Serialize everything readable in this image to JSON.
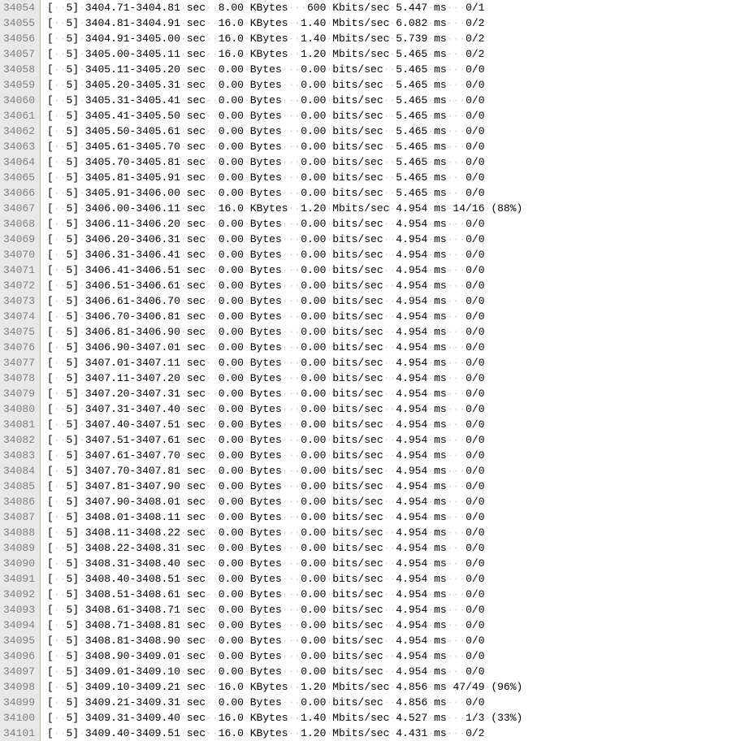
{
  "ws_dot": "·",
  "lines": [
    {
      "ln": "34054",
      "id": "5",
      "interval": "3404.71-3404.81",
      "unit_t": "sec",
      "amt": "8.00",
      "amt_u": "KBytes",
      "rate": "600",
      "rate_u": "Kbits/sec",
      "jit": "5.447",
      "jit_u": "ms",
      "loss": "0/1",
      "pct": ""
    },
    {
      "ln": "34055",
      "id": "5",
      "interval": "3404.81-3404.91",
      "unit_t": "sec",
      "amt": "16.0",
      "amt_u": "KBytes",
      "rate": "1.40",
      "rate_u": "Mbits/sec",
      "jit": "6.082",
      "jit_u": "ms",
      "loss": "0/2",
      "pct": ""
    },
    {
      "ln": "34056",
      "id": "5",
      "interval": "3404.91-3405.00",
      "unit_t": "sec",
      "amt": "16.0",
      "amt_u": "KBytes",
      "rate": "1.40",
      "rate_u": "Mbits/sec",
      "jit": "5.739",
      "jit_u": "ms",
      "loss": "0/2",
      "pct": ""
    },
    {
      "ln": "34057",
      "id": "5",
      "interval": "3405.00-3405.11",
      "unit_t": "sec",
      "amt": "16.0",
      "amt_u": "KBytes",
      "rate": "1.20",
      "rate_u": "Mbits/sec",
      "jit": "5.465",
      "jit_u": "ms",
      "loss": "0/2",
      "pct": ""
    },
    {
      "ln": "34058",
      "id": "5",
      "interval": "3405.11-3405.20",
      "unit_t": "sec",
      "amt": "0.00",
      "amt_u": "Bytes",
      "rate": "0.00",
      "rate_u": "bits/sec",
      "jit": "5.465",
      "jit_u": "ms",
      "loss": "0/0",
      "pct": ""
    },
    {
      "ln": "34059",
      "id": "5",
      "interval": "3405.20-3405.31",
      "unit_t": "sec",
      "amt": "0.00",
      "amt_u": "Bytes",
      "rate": "0.00",
      "rate_u": "bits/sec",
      "jit": "5.465",
      "jit_u": "ms",
      "loss": "0/0",
      "pct": ""
    },
    {
      "ln": "34060",
      "id": "5",
      "interval": "3405.31-3405.41",
      "unit_t": "sec",
      "amt": "0.00",
      "amt_u": "Bytes",
      "rate": "0.00",
      "rate_u": "bits/sec",
      "jit": "5.465",
      "jit_u": "ms",
      "loss": "0/0",
      "pct": ""
    },
    {
      "ln": "34061",
      "id": "5",
      "interval": "3405.41-3405.50",
      "unit_t": "sec",
      "amt": "0.00",
      "amt_u": "Bytes",
      "rate": "0.00",
      "rate_u": "bits/sec",
      "jit": "5.465",
      "jit_u": "ms",
      "loss": "0/0",
      "pct": ""
    },
    {
      "ln": "34062",
      "id": "5",
      "interval": "3405.50-3405.61",
      "unit_t": "sec",
      "amt": "0.00",
      "amt_u": "Bytes",
      "rate": "0.00",
      "rate_u": "bits/sec",
      "jit": "5.465",
      "jit_u": "ms",
      "loss": "0/0",
      "pct": ""
    },
    {
      "ln": "34063",
      "id": "5",
      "interval": "3405.61-3405.70",
      "unit_t": "sec",
      "amt": "0.00",
      "amt_u": "Bytes",
      "rate": "0.00",
      "rate_u": "bits/sec",
      "jit": "5.465",
      "jit_u": "ms",
      "loss": "0/0",
      "pct": ""
    },
    {
      "ln": "34064",
      "id": "5",
      "interval": "3405.70-3405.81",
      "unit_t": "sec",
      "amt": "0.00",
      "amt_u": "Bytes",
      "rate": "0.00",
      "rate_u": "bits/sec",
      "jit": "5.465",
      "jit_u": "ms",
      "loss": "0/0",
      "pct": ""
    },
    {
      "ln": "34065",
      "id": "5",
      "interval": "3405.81-3405.91",
      "unit_t": "sec",
      "amt": "0.00",
      "amt_u": "Bytes",
      "rate": "0.00",
      "rate_u": "bits/sec",
      "jit": "5.465",
      "jit_u": "ms",
      "loss": "0/0",
      "pct": ""
    },
    {
      "ln": "34066",
      "id": "5",
      "interval": "3405.91-3406.00",
      "unit_t": "sec",
      "amt": "0.00",
      "amt_u": "Bytes",
      "rate": "0.00",
      "rate_u": "bits/sec",
      "jit": "5.465",
      "jit_u": "ms",
      "loss": "0/0",
      "pct": ""
    },
    {
      "ln": "34067",
      "id": "5",
      "interval": "3406.00-3406.11",
      "unit_t": "sec",
      "amt": "16.0",
      "amt_u": "KBytes",
      "rate": "1.20",
      "rate_u": "Mbits/sec",
      "jit": "4.954",
      "jit_u": "ms",
      "loss": "14/16",
      "pct": "(88%)"
    },
    {
      "ln": "34068",
      "id": "5",
      "interval": "3406.11-3406.20",
      "unit_t": "sec",
      "amt": "0.00",
      "amt_u": "Bytes",
      "rate": "0.00",
      "rate_u": "bits/sec",
      "jit": "4.954",
      "jit_u": "ms",
      "loss": "0/0",
      "pct": ""
    },
    {
      "ln": "34069",
      "id": "5",
      "interval": "3406.20-3406.31",
      "unit_t": "sec",
      "amt": "0.00",
      "amt_u": "Bytes",
      "rate": "0.00",
      "rate_u": "bits/sec",
      "jit": "4.954",
      "jit_u": "ms",
      "loss": "0/0",
      "pct": ""
    },
    {
      "ln": "34070",
      "id": "5",
      "interval": "3406.31-3406.41",
      "unit_t": "sec",
      "amt": "0.00",
      "amt_u": "Bytes",
      "rate": "0.00",
      "rate_u": "bits/sec",
      "jit": "4.954",
      "jit_u": "ms",
      "loss": "0/0",
      "pct": ""
    },
    {
      "ln": "34071",
      "id": "5",
      "interval": "3406.41-3406.51",
      "unit_t": "sec",
      "amt": "0.00",
      "amt_u": "Bytes",
      "rate": "0.00",
      "rate_u": "bits/sec",
      "jit": "4.954",
      "jit_u": "ms",
      "loss": "0/0",
      "pct": ""
    },
    {
      "ln": "34072",
      "id": "5",
      "interval": "3406.51-3406.61",
      "unit_t": "sec",
      "amt": "0.00",
      "amt_u": "Bytes",
      "rate": "0.00",
      "rate_u": "bits/sec",
      "jit": "4.954",
      "jit_u": "ms",
      "loss": "0/0",
      "pct": ""
    },
    {
      "ln": "34073",
      "id": "5",
      "interval": "3406.61-3406.70",
      "unit_t": "sec",
      "amt": "0.00",
      "amt_u": "Bytes",
      "rate": "0.00",
      "rate_u": "bits/sec",
      "jit": "4.954",
      "jit_u": "ms",
      "loss": "0/0",
      "pct": ""
    },
    {
      "ln": "34074",
      "id": "5",
      "interval": "3406.70-3406.81",
      "unit_t": "sec",
      "amt": "0.00",
      "amt_u": "Bytes",
      "rate": "0.00",
      "rate_u": "bits/sec",
      "jit": "4.954",
      "jit_u": "ms",
      "loss": "0/0",
      "pct": ""
    },
    {
      "ln": "34075",
      "id": "5",
      "interval": "3406.81-3406.90",
      "unit_t": "sec",
      "amt": "0.00",
      "amt_u": "Bytes",
      "rate": "0.00",
      "rate_u": "bits/sec",
      "jit": "4.954",
      "jit_u": "ms",
      "loss": "0/0",
      "pct": ""
    },
    {
      "ln": "34076",
      "id": "5",
      "interval": "3406.90-3407.01",
      "unit_t": "sec",
      "amt": "0.00",
      "amt_u": "Bytes",
      "rate": "0.00",
      "rate_u": "bits/sec",
      "jit": "4.954",
      "jit_u": "ms",
      "loss": "0/0",
      "pct": ""
    },
    {
      "ln": "34077",
      "id": "5",
      "interval": "3407.01-3407.11",
      "unit_t": "sec",
      "amt": "0.00",
      "amt_u": "Bytes",
      "rate": "0.00",
      "rate_u": "bits/sec",
      "jit": "4.954",
      "jit_u": "ms",
      "loss": "0/0",
      "pct": ""
    },
    {
      "ln": "34078",
      "id": "5",
      "interval": "3407.11-3407.20",
      "unit_t": "sec",
      "amt": "0.00",
      "amt_u": "Bytes",
      "rate": "0.00",
      "rate_u": "bits/sec",
      "jit": "4.954",
      "jit_u": "ms",
      "loss": "0/0",
      "pct": ""
    },
    {
      "ln": "34079",
      "id": "5",
      "interval": "3407.20-3407.31",
      "unit_t": "sec",
      "amt": "0.00",
      "amt_u": "Bytes",
      "rate": "0.00",
      "rate_u": "bits/sec",
      "jit": "4.954",
      "jit_u": "ms",
      "loss": "0/0",
      "pct": ""
    },
    {
      "ln": "34080",
      "id": "5",
      "interval": "3407.31-3407.40",
      "unit_t": "sec",
      "amt": "0.00",
      "amt_u": "Bytes",
      "rate": "0.00",
      "rate_u": "bits/sec",
      "jit": "4.954",
      "jit_u": "ms",
      "loss": "0/0",
      "pct": ""
    },
    {
      "ln": "34081",
      "id": "5",
      "interval": "3407.40-3407.51",
      "unit_t": "sec",
      "amt": "0.00",
      "amt_u": "Bytes",
      "rate": "0.00",
      "rate_u": "bits/sec",
      "jit": "4.954",
      "jit_u": "ms",
      "loss": "0/0",
      "pct": ""
    },
    {
      "ln": "34082",
      "id": "5",
      "interval": "3407.51-3407.61",
      "unit_t": "sec",
      "amt": "0.00",
      "amt_u": "Bytes",
      "rate": "0.00",
      "rate_u": "bits/sec",
      "jit": "4.954",
      "jit_u": "ms",
      "loss": "0/0",
      "pct": ""
    },
    {
      "ln": "34083",
      "id": "5",
      "interval": "3407.61-3407.70",
      "unit_t": "sec",
      "amt": "0.00",
      "amt_u": "Bytes",
      "rate": "0.00",
      "rate_u": "bits/sec",
      "jit": "4.954",
      "jit_u": "ms",
      "loss": "0/0",
      "pct": ""
    },
    {
      "ln": "34084",
      "id": "5",
      "interval": "3407.70-3407.81",
      "unit_t": "sec",
      "amt": "0.00",
      "amt_u": "Bytes",
      "rate": "0.00",
      "rate_u": "bits/sec",
      "jit": "4.954",
      "jit_u": "ms",
      "loss": "0/0",
      "pct": ""
    },
    {
      "ln": "34085",
      "id": "5",
      "interval": "3407.81-3407.90",
      "unit_t": "sec",
      "amt": "0.00",
      "amt_u": "Bytes",
      "rate": "0.00",
      "rate_u": "bits/sec",
      "jit": "4.954",
      "jit_u": "ms",
      "loss": "0/0",
      "pct": ""
    },
    {
      "ln": "34086",
      "id": "5",
      "interval": "3407.90-3408.01",
      "unit_t": "sec",
      "amt": "0.00",
      "amt_u": "Bytes",
      "rate": "0.00",
      "rate_u": "bits/sec",
      "jit": "4.954",
      "jit_u": "ms",
      "loss": "0/0",
      "pct": ""
    },
    {
      "ln": "34087",
      "id": "5",
      "interval": "3408.01-3408.11",
      "unit_t": "sec",
      "amt": "0.00",
      "amt_u": "Bytes",
      "rate": "0.00",
      "rate_u": "bits/sec",
      "jit": "4.954",
      "jit_u": "ms",
      "loss": "0/0",
      "pct": ""
    },
    {
      "ln": "34088",
      "id": "5",
      "interval": "3408.11-3408.22",
      "unit_t": "sec",
      "amt": "0.00",
      "amt_u": "Bytes",
      "rate": "0.00",
      "rate_u": "bits/sec",
      "jit": "4.954",
      "jit_u": "ms",
      "loss": "0/0",
      "pct": ""
    },
    {
      "ln": "34089",
      "id": "5",
      "interval": "3408.22-3408.31",
      "unit_t": "sec",
      "amt": "0.00",
      "amt_u": "Bytes",
      "rate": "0.00",
      "rate_u": "bits/sec",
      "jit": "4.954",
      "jit_u": "ms",
      "loss": "0/0",
      "pct": ""
    },
    {
      "ln": "34090",
      "id": "5",
      "interval": "3408.31-3408.40",
      "unit_t": "sec",
      "amt": "0.00",
      "amt_u": "Bytes",
      "rate": "0.00",
      "rate_u": "bits/sec",
      "jit": "4.954",
      "jit_u": "ms",
      "loss": "0/0",
      "pct": ""
    },
    {
      "ln": "34091",
      "id": "5",
      "interval": "3408.40-3408.51",
      "unit_t": "sec",
      "amt": "0.00",
      "amt_u": "Bytes",
      "rate": "0.00",
      "rate_u": "bits/sec",
      "jit": "4.954",
      "jit_u": "ms",
      "loss": "0/0",
      "pct": ""
    },
    {
      "ln": "34092",
      "id": "5",
      "interval": "3408.51-3408.61",
      "unit_t": "sec",
      "amt": "0.00",
      "amt_u": "Bytes",
      "rate": "0.00",
      "rate_u": "bits/sec",
      "jit": "4.954",
      "jit_u": "ms",
      "loss": "0/0",
      "pct": ""
    },
    {
      "ln": "34093",
      "id": "5",
      "interval": "3408.61-3408.71",
      "unit_t": "sec",
      "amt": "0.00",
      "amt_u": "Bytes",
      "rate": "0.00",
      "rate_u": "bits/sec",
      "jit": "4.954",
      "jit_u": "ms",
      "loss": "0/0",
      "pct": ""
    },
    {
      "ln": "34094",
      "id": "5",
      "interval": "3408.71-3408.81",
      "unit_t": "sec",
      "amt": "0.00",
      "amt_u": "Bytes",
      "rate": "0.00",
      "rate_u": "bits/sec",
      "jit": "4.954",
      "jit_u": "ms",
      "loss": "0/0",
      "pct": ""
    },
    {
      "ln": "34095",
      "id": "5",
      "interval": "3408.81-3408.90",
      "unit_t": "sec",
      "amt": "0.00",
      "amt_u": "Bytes",
      "rate": "0.00",
      "rate_u": "bits/sec",
      "jit": "4.954",
      "jit_u": "ms",
      "loss": "0/0",
      "pct": ""
    },
    {
      "ln": "34096",
      "id": "5",
      "interval": "3408.90-3409.01",
      "unit_t": "sec",
      "amt": "0.00",
      "amt_u": "Bytes",
      "rate": "0.00",
      "rate_u": "bits/sec",
      "jit": "4.954",
      "jit_u": "ms",
      "loss": "0/0",
      "pct": ""
    },
    {
      "ln": "34097",
      "id": "5",
      "interval": "3409.01-3409.10",
      "unit_t": "sec",
      "amt": "0.00",
      "amt_u": "Bytes",
      "rate": "0.00",
      "rate_u": "bits/sec",
      "jit": "4.954",
      "jit_u": "ms",
      "loss": "0/0",
      "pct": ""
    },
    {
      "ln": "34098",
      "id": "5",
      "interval": "3409.10-3409.21",
      "unit_t": "sec",
      "amt": "16.0",
      "amt_u": "KBytes",
      "rate": "1.20",
      "rate_u": "Mbits/sec",
      "jit": "4.856",
      "jit_u": "ms",
      "loss": "47/49",
      "pct": "(96%)"
    },
    {
      "ln": "34099",
      "id": "5",
      "interval": "3409.21-3409.31",
      "unit_t": "sec",
      "amt": "0.00",
      "amt_u": "Bytes",
      "rate": "0.00",
      "rate_u": "bits/sec",
      "jit": "4.856",
      "jit_u": "ms",
      "loss": "0/0",
      "pct": ""
    },
    {
      "ln": "34100",
      "id": "5",
      "interval": "3409.31-3409.40",
      "unit_t": "sec",
      "amt": "16.0",
      "amt_u": "KBytes",
      "rate": "1.40",
      "rate_u": "Mbits/sec",
      "jit": "4.527",
      "jit_u": "ms",
      "loss": "1/3",
      "pct": "(33%)"
    },
    {
      "ln": "34101",
      "id": "5",
      "interval": "3409.40-3409.51",
      "unit_t": "sec",
      "amt": "16.0",
      "amt_u": "KBytes",
      "rate": "1.20",
      "rate_u": "Mbits/sec",
      "jit": "4.431",
      "jit_u": "ms",
      "loss": "0/2",
      "pct": ""
    }
  ]
}
